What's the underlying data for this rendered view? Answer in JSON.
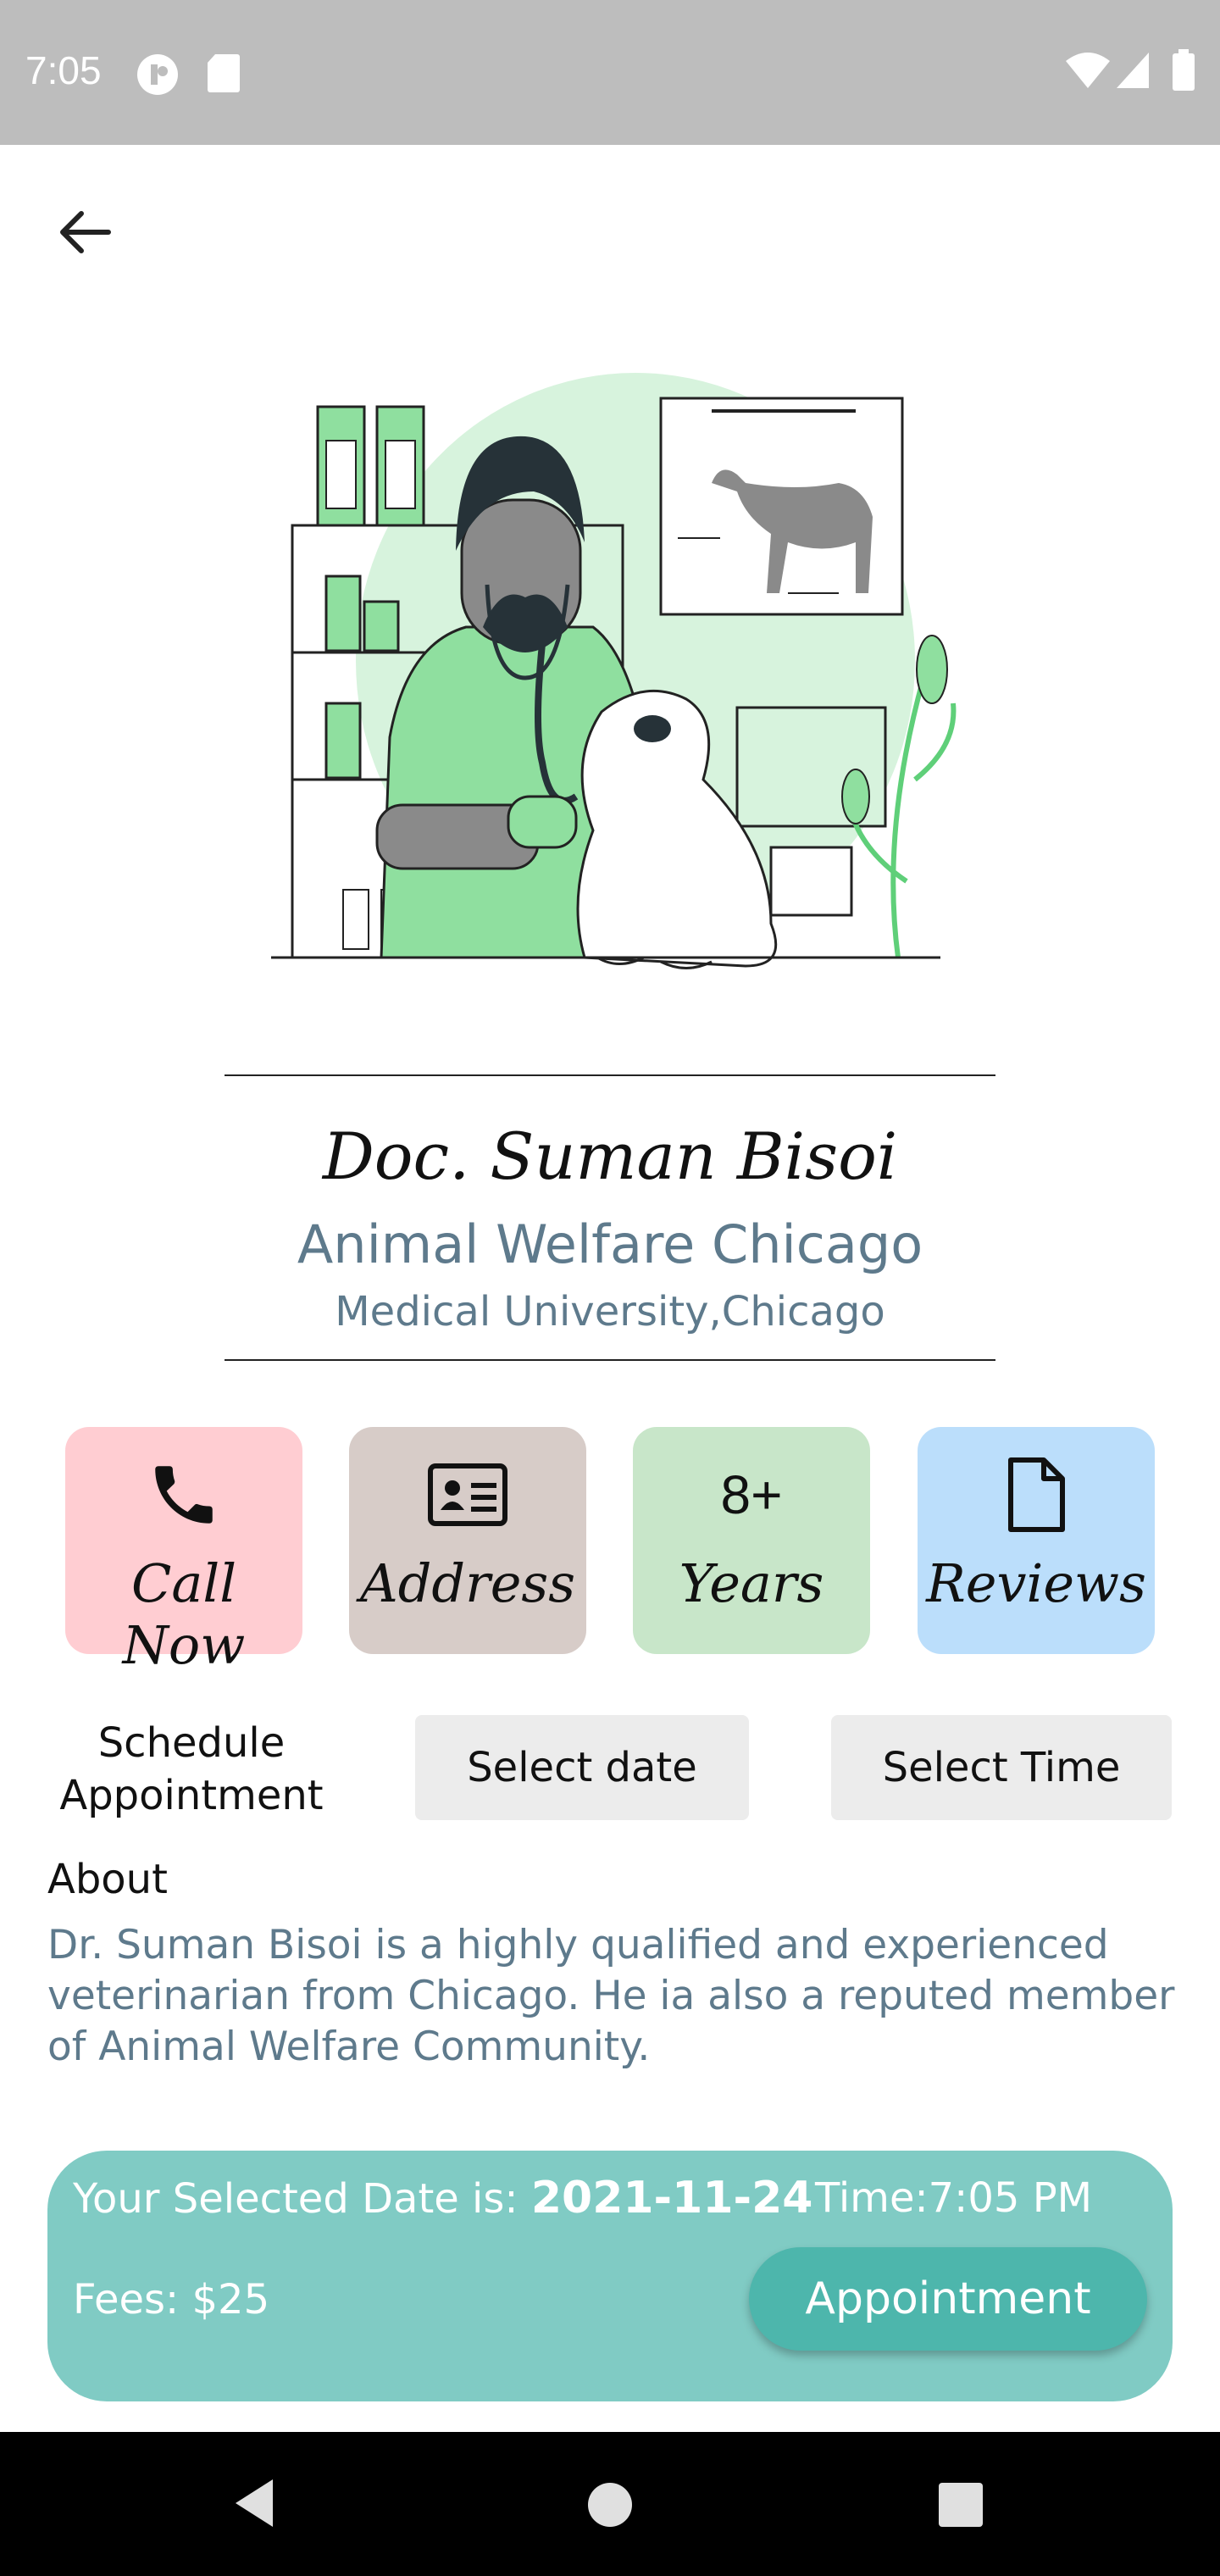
{
  "status_bar": {
    "time": "7:05"
  },
  "doctor": {
    "name": "Doc. Suman Bisoi",
    "organization": "Animal Welfare Chicago",
    "university": "Medical University,Chicago"
  },
  "cards": [
    {
      "label": "Call Now",
      "icon": "phone-icon",
      "color": "#ffcdd2"
    },
    {
      "label": "Address",
      "icon": "address-card-icon",
      "color": "#d7ccc8"
    },
    {
      "number": "8+",
      "label": "Years",
      "color": "#c8e6c9"
    },
    {
      "label": "Reviews",
      "icon": "document-icon",
      "color": "#bbdefb"
    }
  ],
  "schedule": {
    "label_line1": "Schedule",
    "label_line2": "Appointment",
    "date_button": "Select date",
    "time_button": "Select Time"
  },
  "about": {
    "heading": "About",
    "text": "Dr. Suman Bisoi is a highly qualified and experienced veterinarian from Chicago. He ia also a reputed member of Animal Welfare Community."
  },
  "summary": {
    "date_prefix": "Your Selected Date is:",
    "date_value": "2021-11-24",
    "time": "Time:7:05 PM",
    "fees": "Fees: $25",
    "appointment_button": "Appointment"
  },
  "colors": {
    "accent_text": "#5e7a8c",
    "panel": "#80cbc4",
    "appointment_button": "#4db6ac"
  }
}
